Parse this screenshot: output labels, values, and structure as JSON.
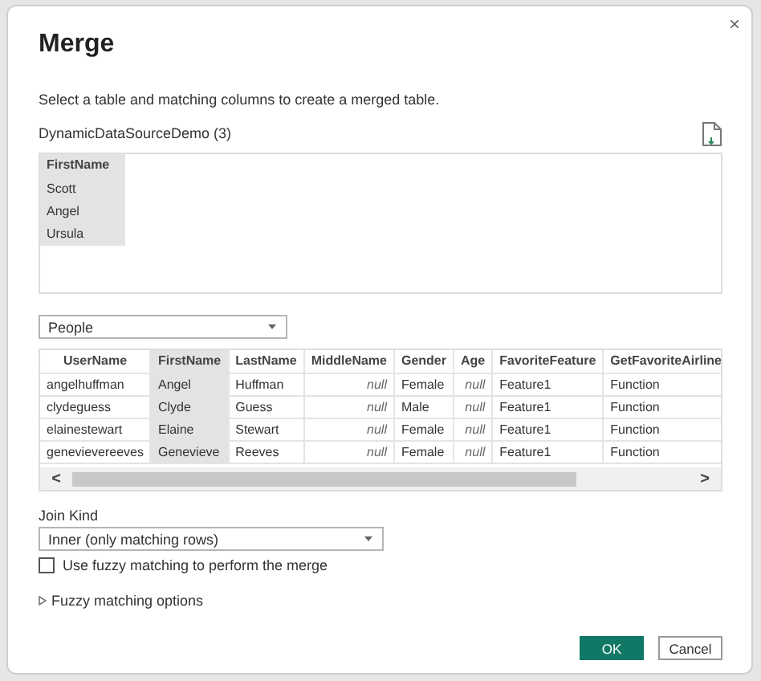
{
  "dialog": {
    "title": "Merge",
    "close": "×",
    "description": "Select a table and matching columns to create a merged table."
  },
  "first_table": {
    "name": "DynamicDataSourceDemo (3)",
    "columns": [
      {
        "label": "FirstName",
        "selected": true
      }
    ],
    "rows": [
      [
        "Scott"
      ],
      [
        "Angel"
      ],
      [
        "Ursula"
      ]
    ]
  },
  "second_table": {
    "select": {
      "value": "People"
    },
    "columns": [
      {
        "label": "UserName",
        "selected": false,
        "kind": "text"
      },
      {
        "label": "FirstName",
        "selected": true,
        "kind": "text"
      },
      {
        "label": "LastName",
        "selected": false,
        "kind": "text"
      },
      {
        "label": "MiddleName",
        "selected": false,
        "kind": "null"
      },
      {
        "label": "Gender",
        "selected": false,
        "kind": "text"
      },
      {
        "label": "Age",
        "selected": false,
        "kind": "null"
      },
      {
        "label": "FavoriteFeature",
        "selected": false,
        "kind": "text"
      },
      {
        "label": "GetFavoriteAirline",
        "selected": false,
        "kind": "text"
      }
    ],
    "rows": [
      [
        "angelhuffman",
        "Angel",
        "Huffman",
        "null",
        "Female",
        "null",
        "Feature1",
        "Function"
      ],
      [
        "clydeguess",
        "Clyde",
        "Guess",
        "null",
        "Male",
        "null",
        "Feature1",
        "Function"
      ],
      [
        "elainestewart",
        "Elaine",
        "Stewart",
        "null",
        "Female",
        "null",
        "Feature1",
        "Function"
      ],
      [
        "genevievereeves",
        "Genevieve",
        "Reeves",
        "null",
        "Female",
        "null",
        "Feature1",
        "Function"
      ]
    ],
    "scroll_left": "<",
    "scroll_right": ">"
  },
  "join_kind": {
    "label": "Join Kind",
    "value": "Inner (only matching rows)"
  },
  "fuzzy": {
    "label": "Use fuzzy matching to perform the merge",
    "checked": false
  },
  "fuzzy_options": {
    "label": "Fuzzy matching options",
    "expanded": false
  },
  "buttons": [
    {
      "label": "OK",
      "kind": "primary"
    },
    {
      "label": "Cancel",
      "kind": "secondary"
    }
  ]
}
